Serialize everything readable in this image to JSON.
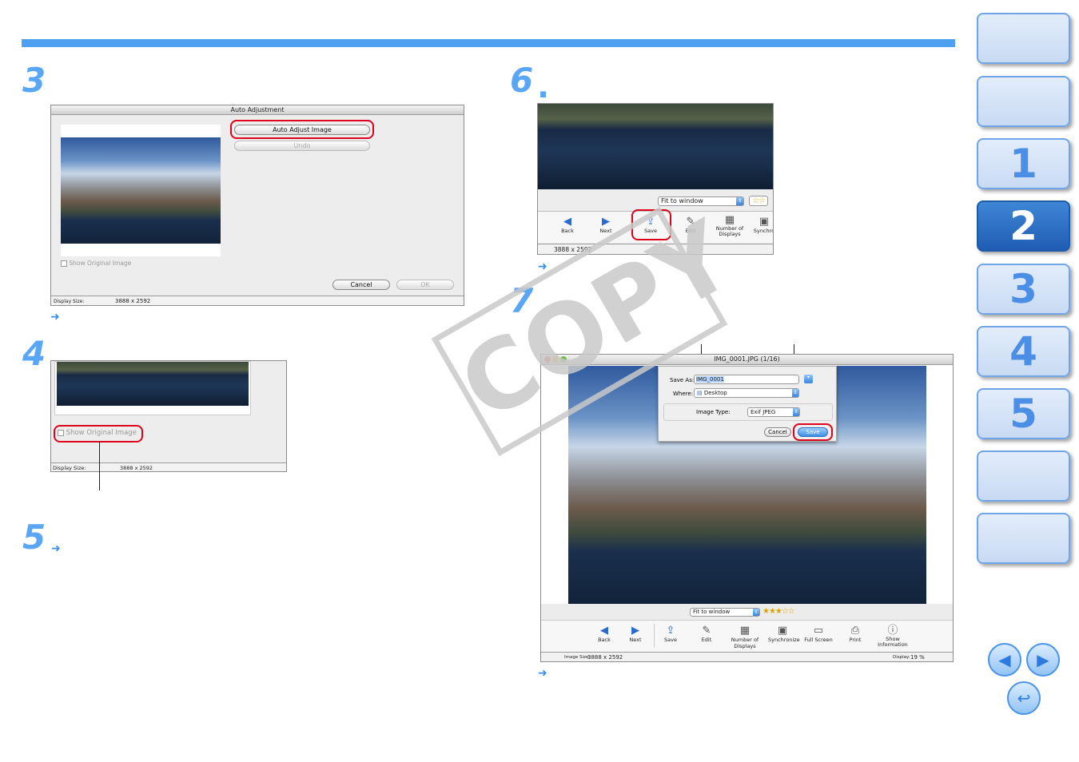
{
  "steps": {
    "s3": "3",
    "s4": "4",
    "s5": "5",
    "s6": "6",
    "s7": "7",
    "dot": ".",
    "arrow": "➜"
  },
  "watermark": "COPY",
  "auto_adjust": {
    "title": "Auto Adjustment",
    "auto_adjust_button": "Auto Adjust Image",
    "undo_button": "Undo",
    "show_original": "Show Original Image",
    "cancel_button": "Cancel",
    "ok_button": "OK",
    "display_size_label": "Display Size:",
    "display_size_value": "3888 x 2592"
  },
  "step4_crop": {
    "show_original": "Show Original Image",
    "display_size_label": "Display Size:",
    "display_size_value": "3888 x 2592"
  },
  "step6_crop": {
    "fit_select": "Fit to window",
    "stars": "☆☆",
    "tools": [
      "Back",
      "Next",
      "Save",
      "Edit",
      "Number of Displays",
      "Synchro"
    ],
    "size_value": "3888 x 2592"
  },
  "save_window": {
    "title": "IMG_0001.JPG (1/16)",
    "save_as_label": "Save As:",
    "save_as_value": "IMG_0001",
    "where_label": "Where:",
    "where_value": "Desktop",
    "image_type_label": "Image Type:",
    "image_type_value": "Exif JPEG",
    "cancel_button": "Cancel",
    "save_button": "Save",
    "fit_select": "Fit to window",
    "stars": "★★★☆☆",
    "tools": [
      "Back",
      "Next",
      "Save",
      "Edit",
      "Number of Displays",
      "Synchronize",
      "Full Screen",
      "Print",
      "Show Information"
    ],
    "image_size_label": "Image Size:",
    "image_size_value": "3888 x 2592",
    "display_label": "Display:",
    "display_value": "19 %"
  },
  "nav_tabs": [
    "",
    "",
    "1",
    "2",
    "3",
    "4",
    "5",
    "",
    ""
  ],
  "active_tab": "2",
  "nav": {
    "prev": "◀",
    "next": "▶",
    "back": "↩"
  }
}
